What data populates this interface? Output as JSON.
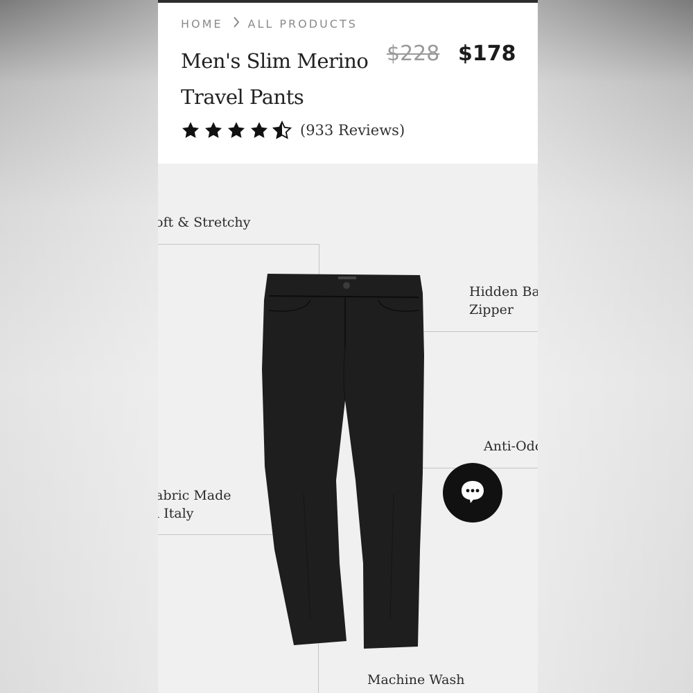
{
  "breadcrumb": {
    "home": "HOME",
    "separator_icon": "chevron-right-icon",
    "all_products": "ALL PRODUCTS"
  },
  "product": {
    "title": "Men's Slim Merino Travel Pants",
    "original_price": "$228",
    "sale_price": "$178",
    "rating": 4.5,
    "rating_max": 5,
    "reviews_text": "(933 Reviews)"
  },
  "features": {
    "soft_stretchy": "oft & Stretchy",
    "hidden_zipper_line1": "Hidden Bac",
    "hidden_zipper_line2": "Zipper",
    "anti_odor": "Anti-Odc",
    "fabric_line1": "abric Made",
    "fabric_line2": "ı Italy",
    "machine_washable": "Machine Wash"
  },
  "chat": {
    "icon": "chat-bubble-icon"
  },
  "colors": {
    "page_bg": "#f0f0f0",
    "header_bg": "#ffffff",
    "price_old": "#9a9a9a",
    "price_new": "#1c1c1c",
    "pants": "#1e1e1e",
    "chat_button": "#111111"
  }
}
